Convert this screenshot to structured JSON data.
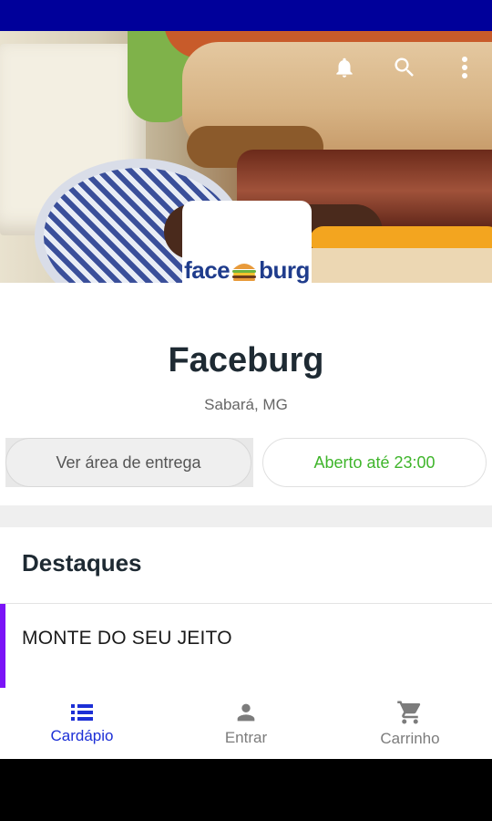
{
  "restaurant": {
    "name": "Faceburg",
    "location": "Sabará, MG",
    "logo_left": "face",
    "logo_right": "burg"
  },
  "actions": {
    "delivery_area_label": "Ver área de entrega",
    "open_status_label": "Aberto até 23:00"
  },
  "highlights": {
    "title": "Destaques",
    "categories": [
      {
        "label": "MONTE DO SEU JEITO"
      }
    ]
  },
  "top_icons": [
    "bell-icon",
    "search-icon",
    "more-vertical-icon"
  ],
  "bottom_nav": {
    "items": [
      {
        "label": "Cardápio",
        "icon": "list-icon",
        "active": true
      },
      {
        "label": "Entrar",
        "icon": "person-icon",
        "active": false
      },
      {
        "label": "Carrinho",
        "icon": "cart-icon",
        "active": false
      }
    ]
  },
  "colors": {
    "status_bar": "#00009a",
    "primary": "#1c2fd6",
    "open_status": "#3fb52b",
    "category_accent": "#7b13f7",
    "logo": "#1f3c8c"
  }
}
